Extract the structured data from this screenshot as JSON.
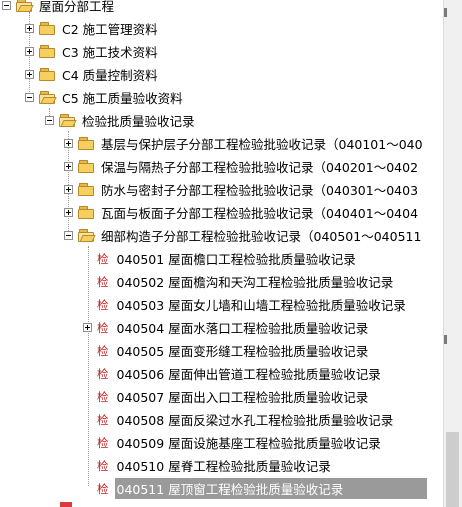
{
  "tree": {
    "root": {
      "label": "屋面分部工程"
    },
    "categories": [
      {
        "label": "C2 施工管理资料"
      },
      {
        "label": "C3 施工技术资料"
      },
      {
        "label": "C4 质量控制资料"
      },
      {
        "label": "C5 施工质量验收资料"
      }
    ],
    "inspection_group": {
      "label": "检验批质量验收记录"
    },
    "subgroups": [
      {
        "label": "基层与保护层子分部工程检验批验收记录（040101～040"
      },
      {
        "label": "保温与隔热子分部工程检验批验收记录（040201～0402"
      },
      {
        "label": "防水与密封子分部工程检验批验收记录（040301～0403"
      },
      {
        "label": "瓦面与板面子分部工程检验批验收记录（040401～0404"
      },
      {
        "label": "细部构造子分部工程检验批验收记录（040501～040511"
      }
    ],
    "check_badge": "检",
    "records": [
      {
        "label": "040501 屋面檐口工程检验批质量验收记录"
      },
      {
        "label": "040502 屋面檐沟和天沟工程检验批质量验收记录"
      },
      {
        "label": "040503 屋面女儿墙和山墙工程检验批质量验收记录"
      },
      {
        "label": "040504 屋面水落口工程检验批质量验收记录"
      },
      {
        "label": "040505 屋面变形缝工程检验批质量验收记录"
      },
      {
        "label": "040506 屋面伸出管道工程检验批质量验收记录"
      },
      {
        "label": "040507 屋面出入口工程检验批质量验收记录"
      },
      {
        "label": "040508 屋面反梁过水孔工程检验批质量验收记录"
      },
      {
        "label": "040509 屋面设施基座工程检验批质量验收记录"
      },
      {
        "label": "040510 屋脊工程检验批质量验收记录"
      },
      {
        "label": "040511 屋顶窗工程检验批质量验收记录"
      }
    ],
    "selected_record": "040511 屋顶窗工程检验批质量验收记录"
  },
  "colors": {
    "selection": "#9a9a9a",
    "check_badge": "#c0201e",
    "folder": "#f6cf5f"
  }
}
